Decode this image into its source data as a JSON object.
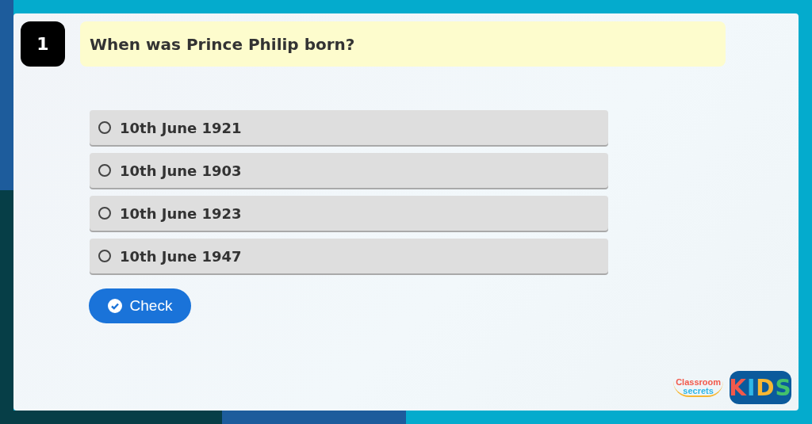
{
  "question": {
    "number": "1",
    "text": "When was Prince Philip born?"
  },
  "options": [
    {
      "label": "10th June 1921",
      "selected": false
    },
    {
      "label": "10th June 1903",
      "selected": false
    },
    {
      "label": "10th June 1923",
      "selected": false
    },
    {
      "label": "10th June 1947",
      "selected": false
    }
  ],
  "check_button": {
    "label": "Check"
  },
  "logo": {
    "brand_top": "Classroom",
    "brand_bottom": "secrets",
    "badge": "KIDS"
  }
}
